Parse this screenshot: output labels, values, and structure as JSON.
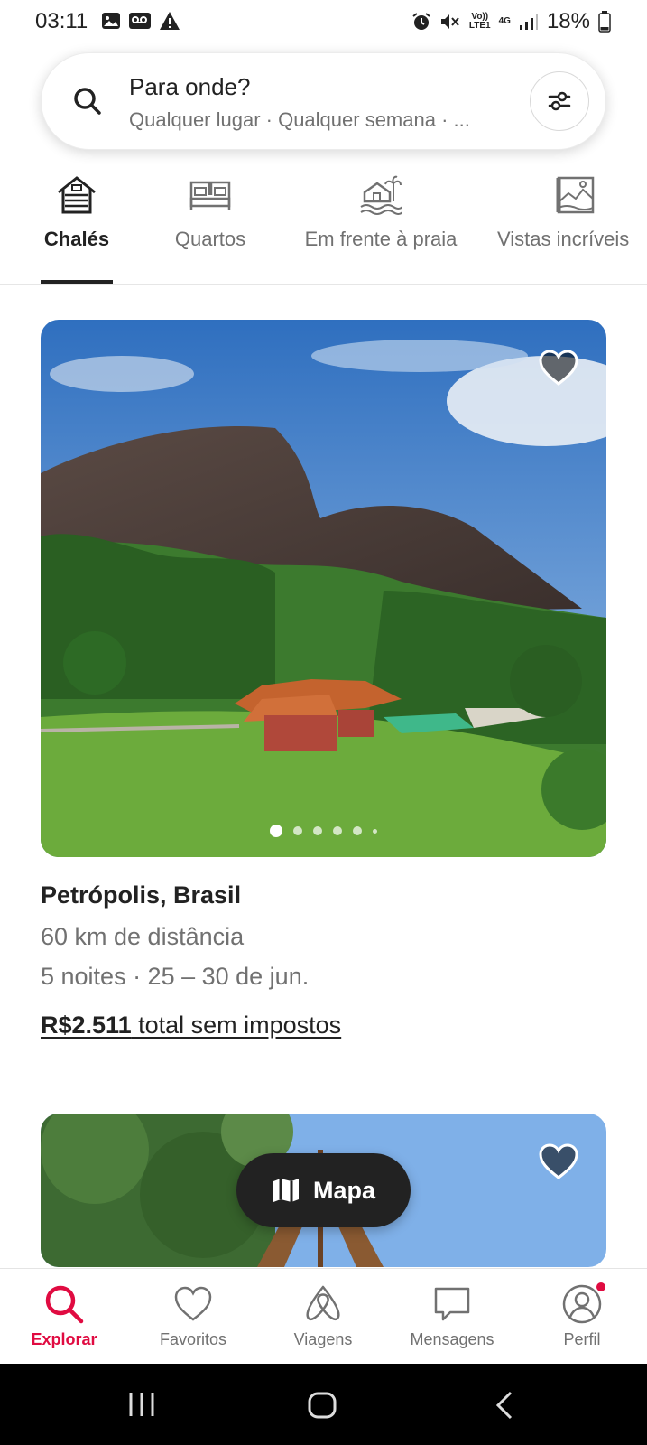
{
  "status_bar": {
    "time": "03:11",
    "battery": "18%",
    "network_volte": "Vo))",
    "network_lte": "LTE1",
    "network_4g": "4G",
    "left_icons": [
      "image-icon",
      "voicemail-icon",
      "warning-icon"
    ],
    "right_icons": [
      "alarm-icon",
      "mute-icon",
      "signal-icon",
      "battery-icon"
    ]
  },
  "search": {
    "title": "Para onde?",
    "subtitle": "Qualquer lugar · Qualquer semana · ...",
    "icon": "search-icon",
    "filter_icon": "filter-sliders-icon"
  },
  "categories": [
    {
      "label": "Chalés",
      "icon": "cabin-icon",
      "active": true
    },
    {
      "label": "Quartos",
      "icon": "beds-icon",
      "active": false
    },
    {
      "label": "Em frente à praia",
      "icon": "beachfront-icon",
      "active": false
    },
    {
      "label": "Vistas incríveis",
      "icon": "amazing-views-icon",
      "active": false
    }
  ],
  "listing": {
    "title": "Petrópolis, Brasil",
    "distance": "60 km de distância",
    "dates": "5 noites · 25 – 30 de jun.",
    "price_amount": "R$2.511",
    "price_suffix": " total sem impostos",
    "photo_count_dots": 6,
    "active_photo_index": 0
  },
  "map_button": {
    "label": "Mapa",
    "icon": "map-icon"
  },
  "bottom_nav": [
    {
      "label": "Explorar",
      "icon": "search-icon",
      "active": true
    },
    {
      "label": "Favoritos",
      "icon": "heart-icon",
      "active": false
    },
    {
      "label": "Viagens",
      "icon": "airbnb-logo-icon",
      "active": false
    },
    {
      "label": "Mensagens",
      "icon": "message-icon",
      "active": false
    },
    {
      "label": "Perfil",
      "icon": "profile-icon",
      "active": false,
      "badge": true
    }
  ],
  "colors": {
    "accent": "#e00b41",
    "text_primary": "#222222",
    "text_secondary": "#717171",
    "map_button": "#222222"
  }
}
